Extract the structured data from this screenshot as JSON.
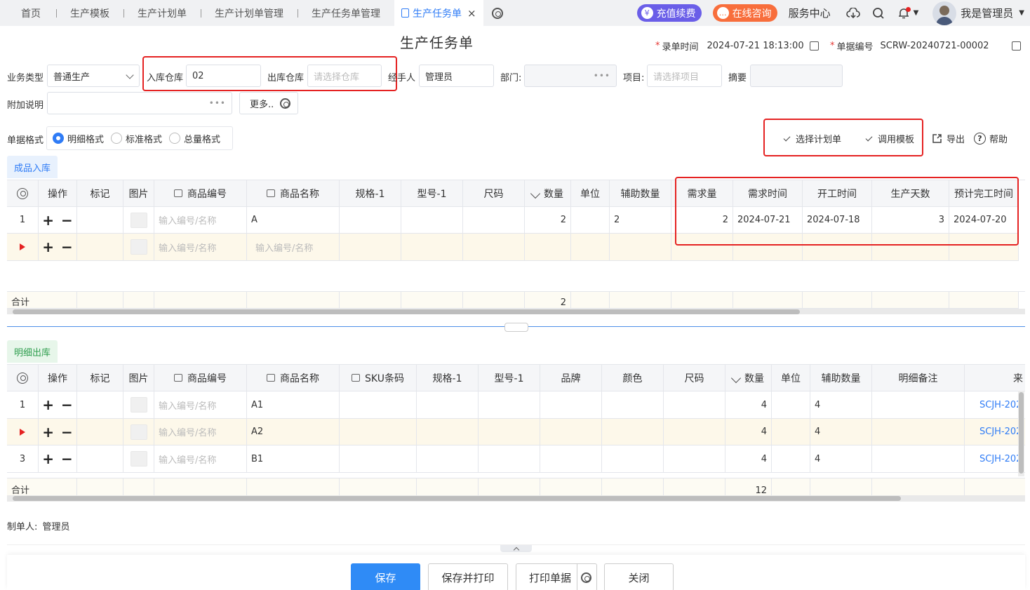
{
  "tabs": [
    {
      "label": "首页"
    },
    {
      "label": "生产模板"
    },
    {
      "label": "生产计划单"
    },
    {
      "label": "生产计划单管理"
    },
    {
      "label": "生产任务单管理"
    },
    {
      "label": "生产任务单"
    }
  ],
  "header": {
    "recharge": "充值续费",
    "consult": "在线咨询",
    "service_center": "服务中心",
    "user_name": "我是管理员",
    "recharge_color": "#6a5ee8",
    "consult_color": "#f86e3c"
  },
  "page": {
    "title": "生产任务单",
    "entry_time_label": "录单时间",
    "entry_time": "2024-07-21 18:13:00",
    "doc_no_label": "单据编号",
    "doc_no": "SCRW-20240721-00002"
  },
  "form": {
    "biz_type_label": "业务类型",
    "biz_type_value": "普通生产",
    "in_wh_label": "入库仓库",
    "in_wh_value": "02",
    "out_wh_label": "出库仓库",
    "out_wh_placeholder": "请选择仓库",
    "handler_label": "经手人",
    "handler_value": "管理员",
    "dept_label": "部门:",
    "project_label": "项目:",
    "project_placeholder": "请选择项目",
    "summary_label": "摘要",
    "remark_label": "附加说明",
    "more_label": "更多..",
    "format_label": "单据格式",
    "formats": [
      "明细格式",
      "标准格式",
      "总量格式"
    ],
    "selected_format": "明细格式"
  },
  "actions": {
    "select_plan": "选择计划单",
    "use_template": "调用模板",
    "export": "导出",
    "help": "帮助"
  },
  "section1": {
    "tab_label": "成品入库",
    "columns": [
      "操作",
      "标记",
      "图片",
      "商品编号",
      "商品名称",
      "规格-1",
      "型号-1",
      "尺码",
      "数量",
      "单位",
      "辅助数量",
      "需求量",
      "需求时间",
      "开工时间",
      "生产天数",
      "预计完工时间"
    ],
    "rows": [
      {
        "no": "1",
        "code_ph": "输入编号/名称",
        "name": "A",
        "qty": "2",
        "aux_qty": "2",
        "demand": "2",
        "demand_time": "2024-07-21",
        "start_time": "2024-07-18",
        "days": "3",
        "finish_time": "2024-07-20"
      },
      {
        "no": "",
        "code_ph": "输入编号/名称",
        "name_ph": "输入编号/名称"
      }
    ],
    "total_label": "合计",
    "total_qty": "2"
  },
  "section2": {
    "tab_label": "明细出库",
    "columns": [
      "操作",
      "标记",
      "图片",
      "商品编号",
      "商品名称",
      "SKU条码",
      "规格-1",
      "型号-1",
      "品牌",
      "颜色",
      "尺码",
      "数量",
      "单位",
      "辅助数量",
      "明细备注",
      "来"
    ],
    "rows": [
      {
        "no": "1",
        "code_ph": "输入编号/名称",
        "name": "A1",
        "qty": "4",
        "aux_qty": "4",
        "source": "SCJH-202"
      },
      {
        "no": "",
        "code_ph": "输入编号/名称",
        "name": "A2",
        "qty": "4",
        "aux_qty": "4",
        "source": "SCJH-202"
      },
      {
        "no": "3",
        "code_ph": "输入编号/名称",
        "name": "B1",
        "qty": "4",
        "aux_qty": "4",
        "source": "SCJH-202"
      }
    ],
    "total_label": "合计",
    "total_qty": "12"
  },
  "footer": {
    "creator_label": "制单人:",
    "creator": "管理员",
    "save": "保存",
    "save_print": "保存并打印",
    "print": "打印单据",
    "close": "关闭"
  }
}
